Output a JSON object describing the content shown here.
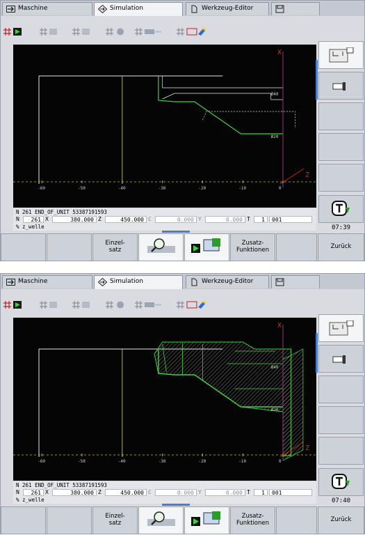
{
  "panels": [
    {
      "tabs": [
        {
          "label": "Maschine",
          "icon": "arrow-right-icon"
        },
        {
          "label": "Simulation",
          "icon": "diamond-arrow-icon"
        },
        {
          "label": "Werkzeug-Editor",
          "icon": "tool-editor-icon"
        },
        {
          "label": "",
          "icon": "save-icon"
        }
      ],
      "x_axis_label": "X",
      "z_axis_label": "Z",
      "z_ticks": [
        "-60",
        "-50",
        "-40",
        "-30",
        "-20",
        "-10",
        "0"
      ],
      "dim_labels": [
        "Ø40",
        "Ø20"
      ],
      "status_line": "N 261 END_OF_UNIT 53387191593",
      "nc": {
        "n_label": "N",
        "n_value": "261",
        "x_label": "X",
        "x_value": "380.000",
        "z_label": "Z",
        "z_value": "450.000",
        "c_label": "C",
        "c_value": "0.000",
        "y_label": "Y",
        "y_value": "0.000",
        "t_label": "T",
        "t_value": "1",
        "t_name": "001"
      },
      "program_name": "% z_welle",
      "time": "07:39",
      "softkeys": {
        "einzelsatz": "Einzel-\nsatz",
        "zusatz": "Zusatz-\nFunktionen",
        "zurueck": "Zurück"
      },
      "machined": false
    },
    {
      "tabs": [
        {
          "label": "Maschine",
          "icon": "arrow-right-icon"
        },
        {
          "label": "Simulation",
          "icon": "diamond-arrow-icon"
        },
        {
          "label": "Werkzeug-Editor",
          "icon": "tool-editor-icon"
        },
        {
          "label": "",
          "icon": "save-icon"
        }
      ],
      "x_axis_label": "X",
      "z_axis_label": "Z",
      "z_ticks": [
        "-60",
        "-50",
        "-40",
        "-30",
        "-20",
        "-10",
        "0"
      ],
      "dim_labels": [
        "Ø40",
        "Ø20"
      ],
      "status_line": "N 261 END_OF_UNIT 53387191593",
      "nc": {
        "n_label": "N",
        "n_value": "261",
        "x_label": "X",
        "x_value": "380.000",
        "z_label": "Z",
        "z_value": "450.000",
        "c_label": "C",
        "c_value": "0.000",
        "y_label": "Y",
        "y_value": "0.000",
        "t_label": "T",
        "t_value": "1",
        "t_name": "001"
      },
      "program_name": "% z_welle",
      "time": "07:40",
      "softkeys": {
        "einzelsatz": "Einzel-\nsatz",
        "zusatz": "Zusatz-\nFunktionen",
        "zurueck": "Zurück"
      },
      "machined": true
    }
  ],
  "colors": {
    "contour_green": "#3fd23a",
    "blank_white": "#e8e8e8",
    "chuck_yellow": "#c8b400",
    "axis_red": "#e02020",
    "tick_yellow": "#d0c000",
    "softkey_gray": "#cdd1d8",
    "accent_blue": "#4a7bd0"
  }
}
